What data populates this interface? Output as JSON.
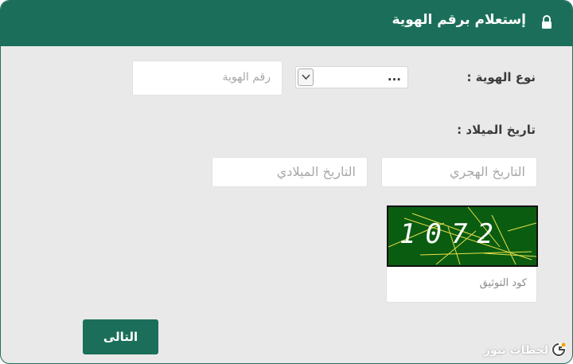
{
  "header": {
    "title": "إستعلام برقم الهوية",
    "icon": "lock-icon"
  },
  "form": {
    "id_type_label": "نوع الهوية :",
    "id_type_selected": "...",
    "id_number_placeholder": "رقم الهوية",
    "dob_label": "تاريخ الميلاد :",
    "hijri_placeholder": "التاريخ الهجري",
    "gregorian_placeholder": "التاريخ الميلادي",
    "captcha_code": "1072",
    "captcha_placeholder": "كود التوثيق",
    "next_label": "التالى"
  },
  "watermark": {
    "text": "لحظات نيوز"
  },
  "colors": {
    "primary": "#1b6f5a",
    "background": "#e9e9e9",
    "captcha_bg": "#0a5d10"
  }
}
